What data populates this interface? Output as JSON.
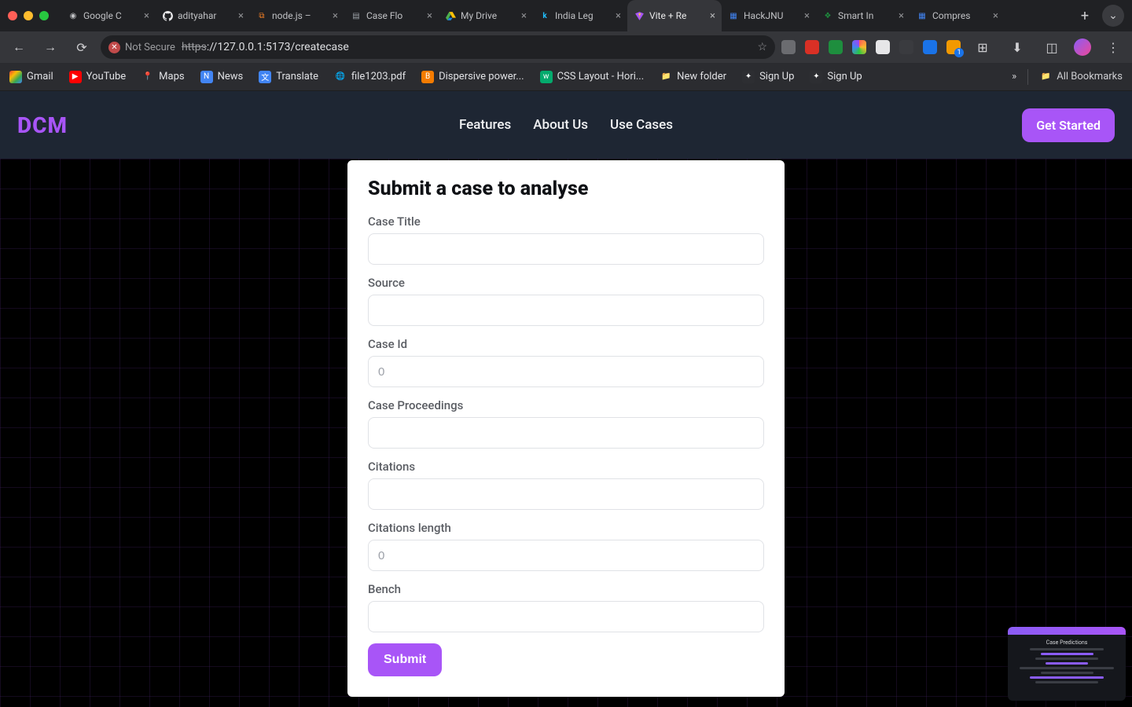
{
  "browser": {
    "tabs": [
      {
        "title": "Google C",
        "active": false
      },
      {
        "title": "adityahar",
        "active": false
      },
      {
        "title": "node.js –",
        "active": false
      },
      {
        "title": "Case Flo",
        "active": false
      },
      {
        "title": "My Drive",
        "active": false
      },
      {
        "title": "India Leg",
        "active": false
      },
      {
        "title": "Vite + Re",
        "active": true
      },
      {
        "title": "HackJNU",
        "active": false
      },
      {
        "title": "Smart In",
        "active": false
      },
      {
        "title": "Compres",
        "active": false
      }
    ],
    "address": {
      "security": "Not Secure",
      "scheme": "https",
      "rest": "://127.0.0.1:5173/createcase"
    },
    "bookmarks": [
      "Gmail",
      "YouTube",
      "Maps",
      "News",
      "Translate",
      "file1203.pdf",
      "Dispersive power...",
      "CSS Layout - Hori...",
      "New folder",
      "Sign Up",
      "Sign Up"
    ],
    "all_bookmarks": "All Bookmarks"
  },
  "nav": {
    "logo": "DCM",
    "links": [
      "Features",
      "About Us",
      "Use Cases"
    ],
    "cta": "Get Started"
  },
  "form": {
    "heading": "Submit a case to analyse",
    "fields": {
      "case_title": {
        "label": "Case Title",
        "placeholder": "",
        "type": "text"
      },
      "source": {
        "label": "Source",
        "placeholder": "",
        "type": "text"
      },
      "case_id": {
        "label": "Case Id",
        "placeholder": "0",
        "type": "number"
      },
      "case_proceedings": {
        "label": "Case Proceedings",
        "placeholder": "",
        "type": "text"
      },
      "citations": {
        "label": "Citations",
        "placeholder": "",
        "type": "text"
      },
      "citations_length": {
        "label": "Citations length",
        "placeholder": "0",
        "type": "number"
      },
      "bench": {
        "label": "Bench",
        "placeholder": "",
        "type": "text"
      }
    },
    "submit": "Submit"
  },
  "pip": {
    "title": "Case Predictions"
  }
}
